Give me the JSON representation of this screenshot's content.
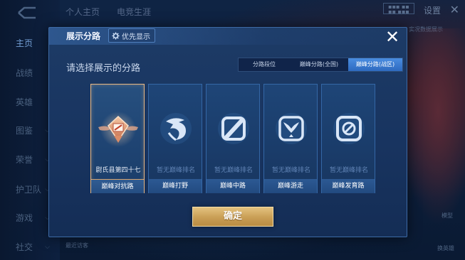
{
  "background": {
    "nav_items": [
      {
        "label": "主页",
        "active": true
      },
      {
        "label": "战绩"
      },
      {
        "label": "英雄"
      },
      {
        "label": "图鉴",
        "chevron": true
      },
      {
        "label": "荣誉",
        "chevron": true
      },
      {
        "label": "护卫队",
        "chevron": true
      },
      {
        "label": "游戏",
        "chevron": true
      },
      {
        "label": "社交",
        "chevron": true
      }
    ],
    "top_tabs": [
      "个人主页",
      "电竞生涯"
    ],
    "settings_label": "设置",
    "side_note": "实况数据展示",
    "recent_label": "最近访客",
    "model_label": "模型",
    "change_hero_label": "换英雄"
  },
  "modal": {
    "title": "展示分路",
    "priority_label": "优先显示",
    "subtitle": "请选择展示的分路",
    "tabs": [
      {
        "label": "分路段位",
        "active": false
      },
      {
        "label": "巅峰分路(全国)",
        "active": false
      },
      {
        "label": "巅峰分路(战区)",
        "active": true
      }
    ],
    "lanes": [
      {
        "rank": "尉氏县第四十七",
        "label": "巅峰对抗路",
        "selected": true,
        "icon": "clash-lane-rank-emblem-icon"
      },
      {
        "rank": "暂无巅峰排名",
        "label": "巅峰打野",
        "selected": false,
        "icon": "jungle-dragon-icon"
      },
      {
        "rank": "暂无巅峰排名",
        "label": "巅峰中路",
        "selected": false,
        "icon": "mid-lane-icon"
      },
      {
        "rank": "暂无巅峰排名",
        "label": "巅峰游走",
        "selected": false,
        "icon": "roam-wings-icon"
      },
      {
        "rank": "暂无巅峰排名",
        "label": "巅峰发育路",
        "selected": false,
        "icon": "farm-lane-icon"
      }
    ],
    "confirm_label": "确定"
  },
  "colors": {
    "accent_blue": "#2e6ac0",
    "selected_border": "#e8b883",
    "confirm_gold": "#c99e55"
  }
}
